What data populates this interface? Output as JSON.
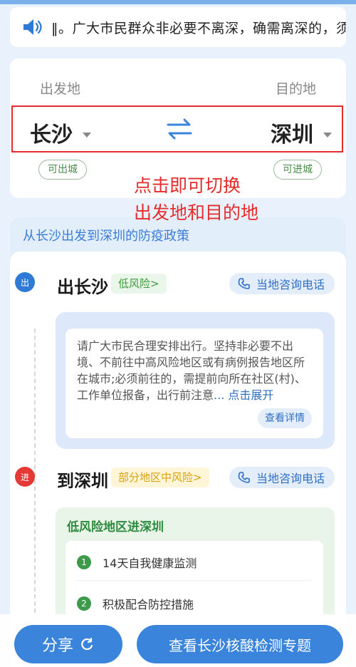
{
  "notice": {
    "text": "‖。广大市民群众非必要不离深，确需离深的，须"
  },
  "route": {
    "from_label": "出发地",
    "to_label": "目的地",
    "from_city": "长沙",
    "to_city": "深圳",
    "from_tag": "可出城",
    "to_tag": "可进城"
  },
  "hint": {
    "line1": "点击即可切换",
    "line2": "出发地和目的地",
    "color": "#e52b2b"
  },
  "policy": {
    "title": "从长沙出发到深圳的防疫政策",
    "out": {
      "node": "出",
      "title": "出长沙",
      "risk": "低风险>",
      "phone": "当地咨询电话",
      "text": "请广大市民合理安排出行。坚持非必要不出境、不前往中高风险地区或有病例报告地区所在城市;必须前往的，需提前向所在社区(村)、工作单位报备，出行前注意",
      "expand": "... 点击展开",
      "detail": "查看详情"
    },
    "in": {
      "node": "进",
      "title": "到深圳",
      "risk": "部分地区中风险>",
      "phone": "当地咨询电话",
      "section_title": "低风险地区进深圳",
      "items": [
        {
          "num": "1",
          "text": "14天自我健康监测"
        },
        {
          "num": "2",
          "text": "积极配合防控措施"
        }
      ]
    }
  },
  "footer": {
    "share": "分享",
    "main": "查看长沙核酸检测专题"
  },
  "colors": {
    "accent": "#3a84dc",
    "low_risk": "#3e9a3e",
    "mid_risk": "#d8a10c",
    "exit_node": "#2d7bd6",
    "enter_node": "#e53935"
  }
}
